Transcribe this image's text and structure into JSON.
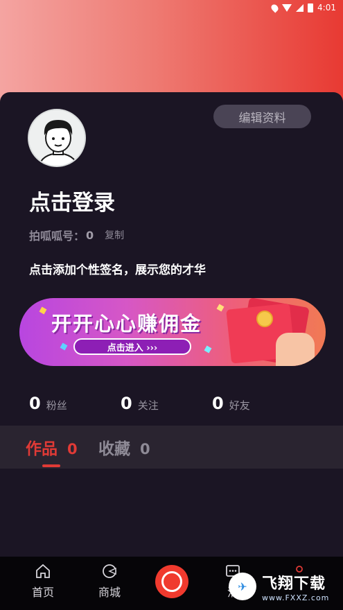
{
  "status_bar": {
    "time": "4:01"
  },
  "profile": {
    "edit_button": "编辑资料",
    "login_title": "点击登录",
    "account_label": "拍呱呱号：",
    "account_value": "0",
    "copy_label": "复制",
    "signature": "点击添加个性签名，展示您的才华"
  },
  "banner": {
    "title": "开开心心赚佣金",
    "button": "点击进入 ›››"
  },
  "stats": [
    {
      "num": "0",
      "label": "粉丝"
    },
    {
      "num": "0",
      "label": "关注"
    },
    {
      "num": "0",
      "label": "好友"
    }
  ],
  "tabs": [
    {
      "label": "作品",
      "count": "0"
    },
    {
      "label": "收藏",
      "count": "0"
    }
  ],
  "bottom_nav": [
    {
      "label": "首页",
      "icon": "home-icon"
    },
    {
      "label": "商城",
      "icon": "shop-icon"
    },
    {
      "label": "消",
      "icon": "message-icon"
    }
  ],
  "watermark": {
    "main": "飞翔下载",
    "sub": "www.FXXZ.com"
  },
  "colors": {
    "accent": "#e03a36",
    "background": "#1b1524",
    "tab_bar": "#2a2430"
  }
}
